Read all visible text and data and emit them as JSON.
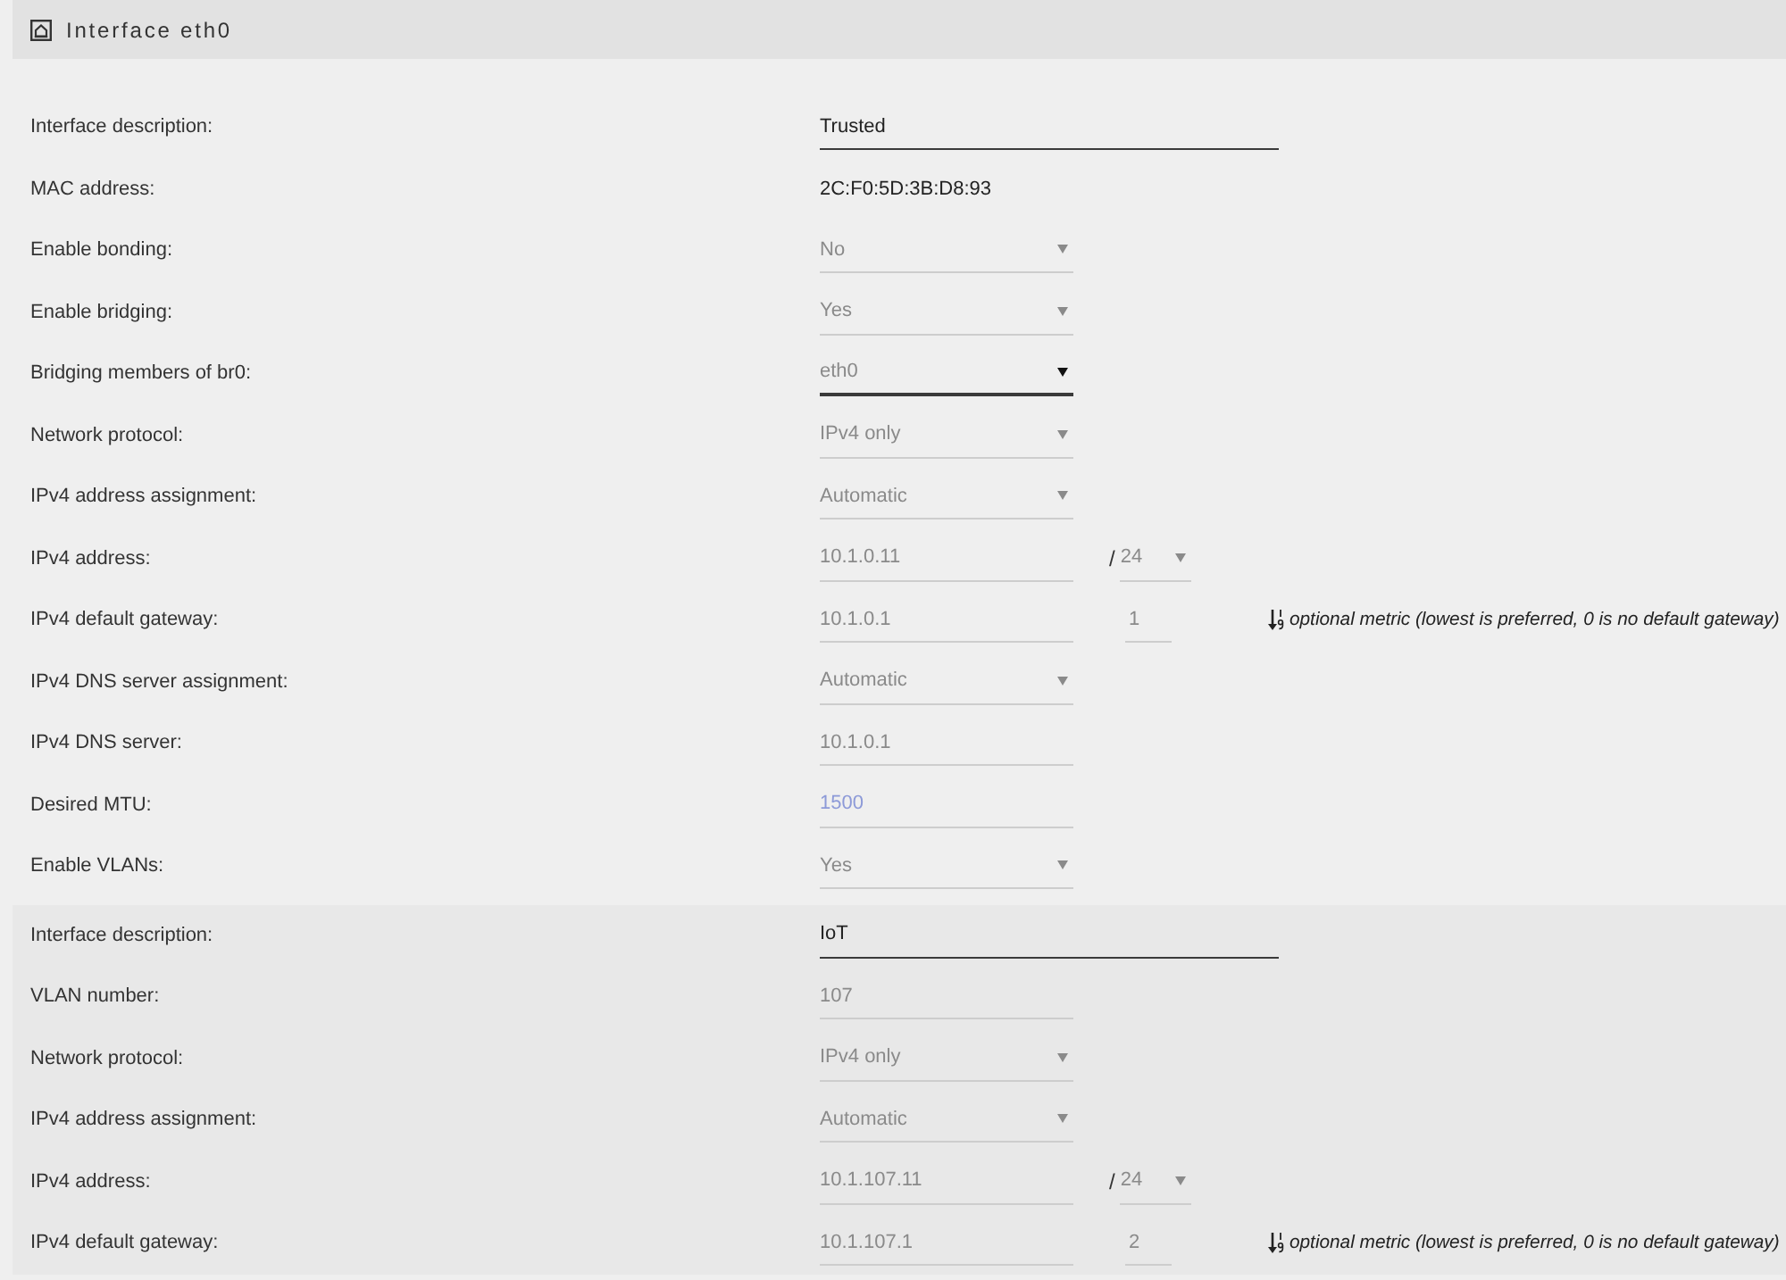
{
  "header": {
    "title": "Interface eth0"
  },
  "sections": [
    {
      "kind": "interface",
      "rows": [
        {
          "label": "Interface description:",
          "field": {
            "kind": "text",
            "value": "Trusted"
          }
        },
        {
          "label": "MAC address:",
          "field": {
            "kind": "static",
            "value": "2C:F0:5D:3B:D8:93"
          }
        },
        {
          "label": "Enable bonding:",
          "field": {
            "kind": "select",
            "value": "No",
            "focused": false
          }
        },
        {
          "label": "Enable bridging:",
          "field": {
            "kind": "select",
            "value": "Yes",
            "focused": false
          }
        },
        {
          "label": "Bridging members of br0:",
          "field": {
            "kind": "select",
            "value": "eth0",
            "focused": true
          }
        },
        {
          "label": "Network protocol:",
          "field": {
            "kind": "select",
            "value": "IPv4 only",
            "focused": false
          }
        },
        {
          "label": "IPv4 address assignment:",
          "field": {
            "kind": "select",
            "value": "Automatic",
            "focused": false
          }
        },
        {
          "label": "IPv4 address:",
          "field": {
            "kind": "input",
            "value": "10.1.0.11"
          },
          "extra": {
            "kind": "prefix",
            "separator": "/",
            "value": "24",
            "focused": false
          }
        },
        {
          "label": "IPv4 default gateway:",
          "field": {
            "kind": "input",
            "value": "10.1.0.1"
          },
          "extra": {
            "kind": "metric",
            "value": "1",
            "note": "optional metric (lowest is preferred, 0 is no default gateway)"
          }
        },
        {
          "label": "IPv4 DNS server assignment:",
          "field": {
            "kind": "select",
            "value": "Automatic",
            "focused": false
          }
        },
        {
          "label": "IPv4 DNS server:",
          "field": {
            "kind": "input",
            "value": "10.1.0.1"
          }
        },
        {
          "label": "Desired MTU:",
          "field": {
            "kind": "input",
            "placeholder": "1500"
          }
        },
        {
          "label": "Enable VLANs:",
          "field": {
            "kind": "select",
            "value": "Yes",
            "focused": false
          }
        }
      ]
    },
    {
      "kind": "vlan",
      "rows": [
        {
          "label": "Interface description:",
          "field": {
            "kind": "text",
            "value": "IoT"
          }
        },
        {
          "label": "VLAN number:",
          "field": {
            "kind": "input",
            "value": "107"
          }
        },
        {
          "label": "Network protocol:",
          "field": {
            "kind": "select",
            "value": "IPv4 only",
            "focused": false
          }
        },
        {
          "label": "IPv4 address assignment:",
          "field": {
            "kind": "select",
            "value": "Automatic",
            "focused": false
          }
        },
        {
          "label": "IPv4 address:",
          "field": {
            "kind": "input",
            "value": "10.1.107.11"
          },
          "extra": {
            "kind": "prefix",
            "separator": "/",
            "value": "24",
            "focused": false
          }
        },
        {
          "label": "IPv4 default gateway:",
          "field": {
            "kind": "input",
            "value": "10.1.107.1"
          },
          "extra": {
            "kind": "metric",
            "value": "2",
            "note": "optional metric (lowest is preferred, 0 is no default gateway)"
          }
        }
      ]
    }
  ]
}
